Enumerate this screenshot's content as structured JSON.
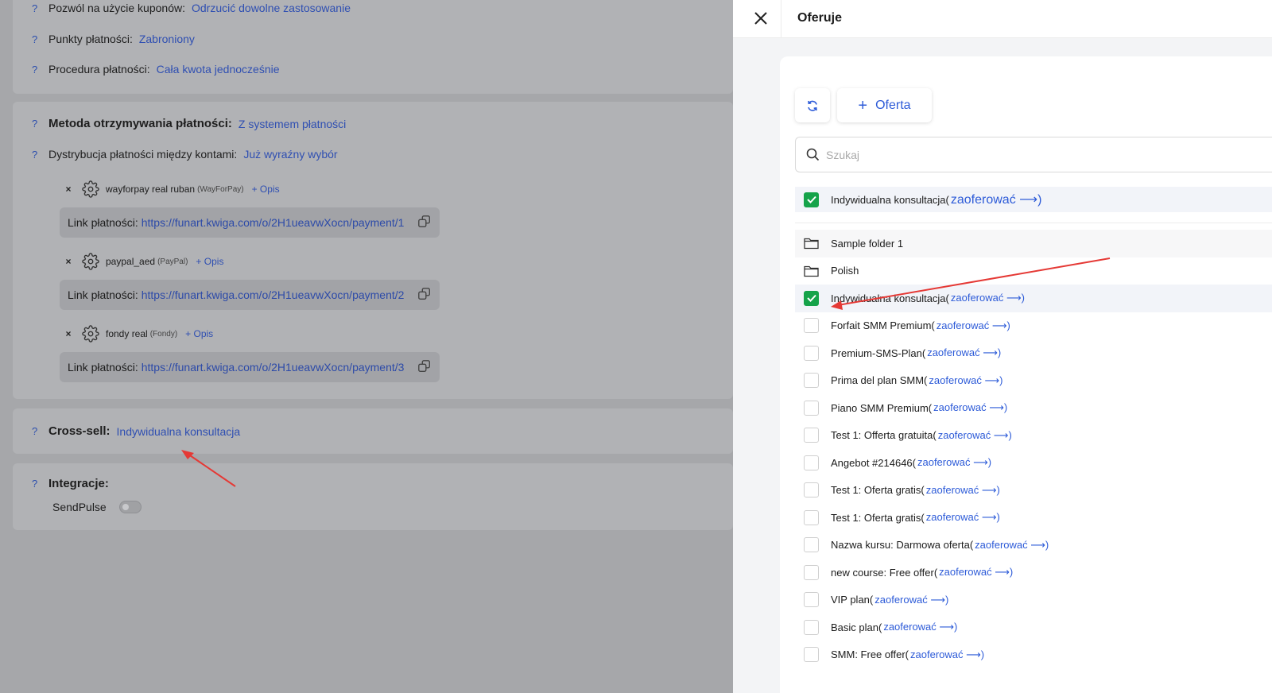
{
  "left": {
    "coupons": {
      "label": "Pozwól na użycie kuponów:",
      "value": "Odrzucić dowolne zastosowanie"
    },
    "payment_points": {
      "label": "Punkty płatności:",
      "value": "Zabroniony"
    },
    "payment_procedure": {
      "label": "Procedura płatności:",
      "value": "Cała kwota jednocześnie"
    },
    "receiving_method": {
      "label": "Metoda otrzymywania płatności:",
      "value": "Z systemem płatności"
    },
    "distribution": {
      "label": "Dystrybucja płatności między kontami:",
      "value": "Już wyraźny wybór"
    },
    "help_mark": "?",
    "remove_mark": "×",
    "methods": [
      {
        "name": "wayforpay real ruban",
        "provider": "(WayForPay)",
        "opis": "+ Opis",
        "link_label": "Link płatności:",
        "url": "https://funart.kwiga.com/o/2H1ueavwXocn/payment/1"
      },
      {
        "name": "paypal_aed",
        "provider": "(PayPal)",
        "opis": "+ Opis",
        "link_label": "Link płatności:",
        "url": "https://funart.kwiga.com/o/2H1ueavwXocn/payment/2"
      },
      {
        "name": "fondy real",
        "provider": "(Fondy)",
        "opis": "+ Opis",
        "link_label": "Link płatności:",
        "url": "https://funart.kwiga.com/o/2H1ueavwXocn/payment/3"
      }
    ],
    "cross_sell": {
      "label": "Cross-sell:",
      "value": "Indywidualna konsultacja"
    },
    "integrations": {
      "label": "Integracje:",
      "sendpulse": "SendPulse",
      "sendpulse_enabled": false
    }
  },
  "drawer": {
    "title": "Oferuje",
    "add_button": "Oferta",
    "add_plus": "+",
    "search_placeholder": "Szukaj",
    "selected": {
      "label": "Indywidualna konsultacja(",
      "offer": "zaoferować  ⟶)",
      "checked": true
    },
    "folders": [
      "Sample folder 1",
      "Polish"
    ],
    "items": [
      {
        "label": "Indywidualna konsultacja(",
        "offer": "zaoferować  ⟶)",
        "checked": true
      },
      {
        "label": "Forfait SMM Premium(",
        "offer": "zaoferować  ⟶)",
        "checked": false
      },
      {
        "label": "Premium-SMS-Plan(",
        "offer": "zaoferować  ⟶)",
        "checked": false
      },
      {
        "label": "Prima del plan SMM(",
        "offer": "zaoferować  ⟶)",
        "checked": false
      },
      {
        "label": "Piano SMM Premium(",
        "offer": "zaoferować  ⟶)",
        "checked": false
      },
      {
        "label": "Test 1: Offerta gratuita(",
        "offer": "zaoferować  ⟶)",
        "checked": false
      },
      {
        "label": "Angebot #214646(",
        "offer": "zaoferować  ⟶)",
        "checked": false
      },
      {
        "label": "Test 1: Oferta gratis(",
        "offer": "zaoferować  ⟶)",
        "checked": false
      },
      {
        "label": "Test 1: Oferta gratis(",
        "offer": "zaoferować  ⟶)",
        "checked": false
      },
      {
        "label": "Nazwa kursu: Darmowa oferta(",
        "offer": "zaoferować  ⟶)",
        "checked": false
      },
      {
        "label": "new course: Free offer(",
        "offer": "zaoferować  ⟶)",
        "checked": false
      },
      {
        "label": "VIP plan(",
        "offer": "zaoferować  ⟶)",
        "checked": false
      },
      {
        "label": "Basic plan(",
        "offer": "zaoferować  ⟶)",
        "checked": false
      },
      {
        "label": "SMM: Free offer(",
        "offer": "zaoferować  ⟶)",
        "checked": false
      }
    ]
  },
  "colors": {
    "accent": "#2d5bd8",
    "checked": "#16a34a",
    "annotation": "#e53935"
  }
}
